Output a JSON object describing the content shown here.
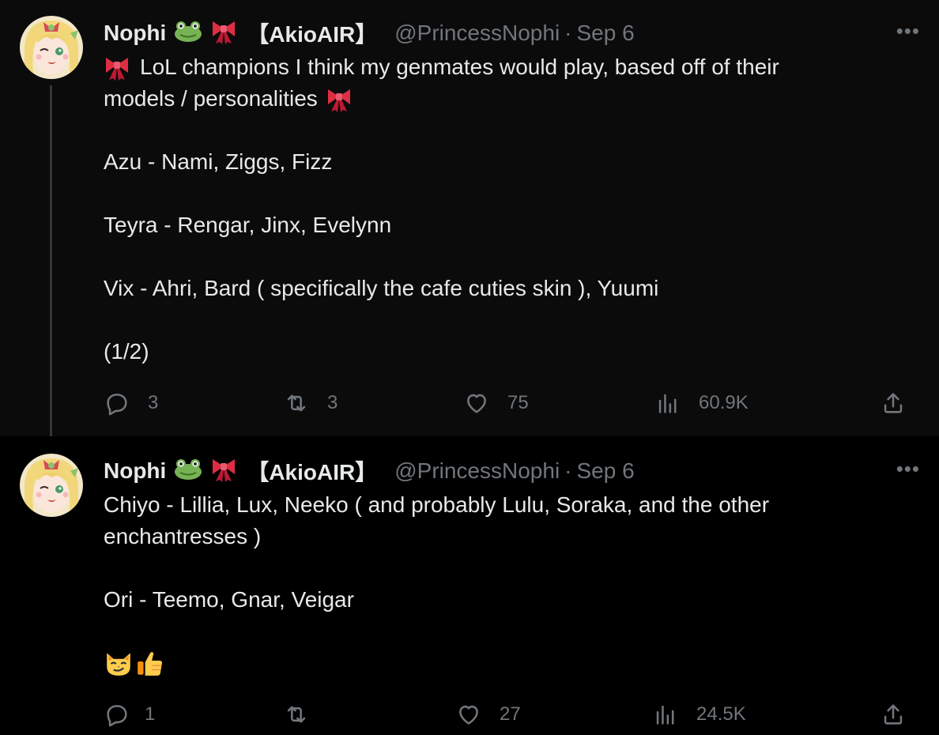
{
  "tweets": [
    {
      "author": {
        "name": "Nophi",
        "emoji_1": "frog-icon",
        "emoji_2": "ribbon-icon",
        "tag": "【AkioAIR】",
        "handle": "@PrincessNophi",
        "separator": "·",
        "date": "Sep 6"
      },
      "more_label": "•••",
      "lines": [
        {
          "text": "LoL champions I think my genmates would play, based off of their",
          "lead_icon": "ribbon-icon"
        },
        {
          "text": "models / personalities",
          "trail_icon": "ribbon-icon"
        },
        {
          "text": ""
        },
        {
          "text": "Azu - Nami, Ziggs, Fizz"
        },
        {
          "text": ""
        },
        {
          "text": "Teyra - Rengar, Jinx, Evelynn"
        },
        {
          "text": ""
        },
        {
          "text": "Vix - Ahri, Bard ( specifically the cafe cuties skin ), Yuumi"
        },
        {
          "text": ""
        },
        {
          "text": "(1/2)"
        }
      ],
      "stats": {
        "replies": "3",
        "reposts": "3",
        "likes": "75",
        "views": "60.9K"
      }
    },
    {
      "author": {
        "name": "Nophi",
        "emoji_1": "frog-icon",
        "emoji_2": "ribbon-icon",
        "tag": "【AkioAIR】",
        "handle": "@PrincessNophi",
        "separator": "·",
        "date": "Sep 6"
      },
      "more_label": "•••",
      "lines": [
        {
          "text": "Chiyo - Lillia, Lux, Neeko ( and probably Lulu, Soraka, and the other"
        },
        {
          "text": "enchantresses )"
        },
        {
          "text": ""
        },
        {
          "text": "Ori - Teemo, Gnar, Veigar"
        },
        {
          "text": ""
        },
        {
          "text": "",
          "icons": [
            "smirking-cat-icon",
            "thumbs-up-icon"
          ]
        }
      ],
      "stats": {
        "replies": "1",
        "reposts": "",
        "likes": "27",
        "views": "24.5K"
      }
    }
  ],
  "colors": {
    "text": "#e7e9ea",
    "muted": "#71767b",
    "bg_highlight": "#0b0b0b",
    "bg": "#000000"
  }
}
